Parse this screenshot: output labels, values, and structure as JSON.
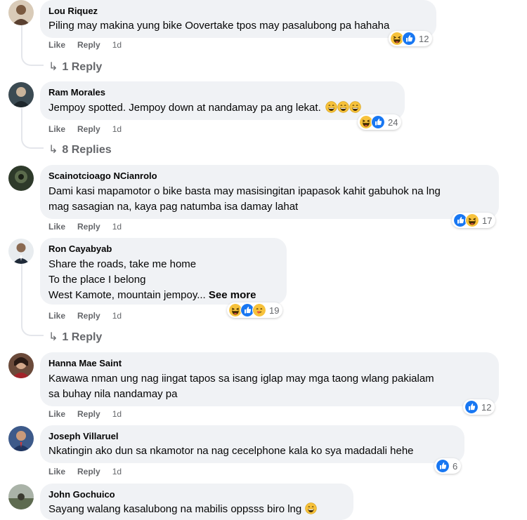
{
  "actions": {
    "like": "Like",
    "reply": "Reply"
  },
  "comments": [
    {
      "author": "Lou Riquez",
      "lines": [
        "Piling may makina yung bike Oovertake tpos may pasalubong pa hahaha"
      ],
      "time": "1d",
      "reactions": "12",
      "replies": "1 Reply"
    },
    {
      "author": "Ram Morales",
      "lines": [
        "Jempoy spotted. Jempoy down at nandamay pa ang lekat."
      ],
      "time": "1d",
      "reactions": "24",
      "replies": "8 Replies"
    },
    {
      "author": "Scainotcioago NCianrolo",
      "lines": [
        "Dami kasi mapamotor o bike basta may masisingitan ipapasok kahit gabuhok na lng",
        "mag sasagian na, kaya pag natumba isa damay lahat"
      ],
      "time": "1d",
      "reactions": "17"
    },
    {
      "author": "Ron Cayabyab",
      "lines": [
        "Share the roads, take me home",
        "To the place I belong",
        "West Kamote, mountain jempoy..."
      ],
      "see_more": "See more",
      "time": "1d",
      "reactions": "19",
      "replies": "1 Reply"
    },
    {
      "author": "Hanna Mae Saint",
      "lines": [
        "Kawawa nman ung nag iingat tapos sa isang iglap may mga taong wlang pakialam",
        "sa buhay nila nandamay pa"
      ],
      "time": "1d",
      "reactions": "12"
    },
    {
      "author": "Joseph Villaruel",
      "lines": [
        "Nkatingin ako dun sa nkamotor na nag cecelphone kala ko sya madadali hehe"
      ],
      "time": "1d",
      "reactions": "6"
    },
    {
      "author": "John Gochuico",
      "lines": [
        "Sayang walang kasalubong na mabilis oppsss biro lng"
      ]
    }
  ],
  "colors": {
    "like_blue": "#1877f2",
    "haha_yellow": "#f7c23b",
    "bubble_bg": "#f0f2f5",
    "meta_gray": "#65676b"
  },
  "icons": {
    "like": "like-reaction-icon",
    "haha": "haha-reaction-icon",
    "reply_arrow": "reply-arrow-icon",
    "smile": "grinning-emoji-icon"
  }
}
